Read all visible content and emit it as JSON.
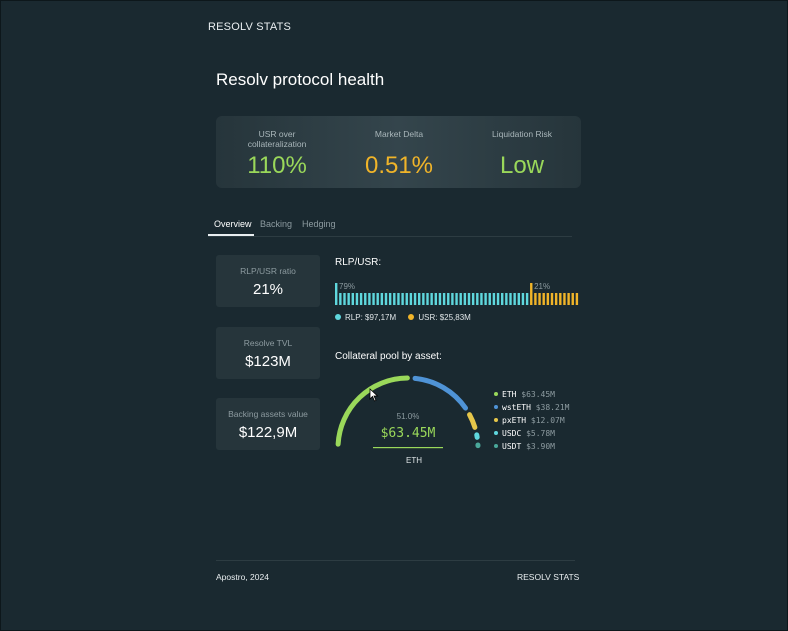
{
  "brand": "RESOLV STATS",
  "page_title": "Resolv protocol health",
  "health_metrics": [
    {
      "label": "USR over collateralization",
      "value": "110%",
      "color": "#9ad85a"
    },
    {
      "label": "Market Delta",
      "value": "0.51%",
      "color": "#f0b429"
    },
    {
      "label": "Liquidation Risk",
      "value": "Low",
      "color": "#9ad85a"
    }
  ],
  "tabs": [
    {
      "label": "Overview",
      "active": true
    },
    {
      "label": "Backing",
      "active": false
    },
    {
      "label": "Hedging",
      "active": false
    }
  ],
  "cards": [
    {
      "label": "RLP/USR ratio",
      "value": "21%"
    },
    {
      "label": "Resolve TVL",
      "value": "$123M"
    },
    {
      "label": "Backing assets value",
      "value": "$122,9M"
    }
  ],
  "ratio": {
    "title": "RLP/USR:",
    "rlp_fraction": 0.79,
    "rlp_pct_label": "79%",
    "usr_pct_label": "21%",
    "rlp_color": "#5fd7dd",
    "usr_color": "#f0b429",
    "legend_rlp": "RLP: $97,17M",
    "legend_usr": "USR: $25,83M"
  },
  "collateral": {
    "title": "Collateral pool by asset:",
    "center_pct": "51.0%",
    "center_value": "$63.45M",
    "center_asset": "ETH",
    "assets": [
      {
        "name": "ETH",
        "amount": "$63.45M",
        "share": 51.0,
        "color": "#9ad85a"
      },
      {
        "name": "wstETH",
        "amount": "$38.21M",
        "share": 30.7,
        "color": "#4f93d6"
      },
      {
        "name": "pxETH",
        "amount": "$12.07M",
        "share": 9.7,
        "color": "#e6c64a"
      },
      {
        "name": "USDC",
        "amount": "$5.78M",
        "share": 4.6,
        "color": "#5fd7dd"
      },
      {
        "name": "USDT",
        "amount": "$3.90M",
        "share": 3.1,
        "color": "#4aa89a"
      }
    ]
  },
  "footer": {
    "left": "Apostro, 2024",
    "right": "RESOLV STATS"
  }
}
